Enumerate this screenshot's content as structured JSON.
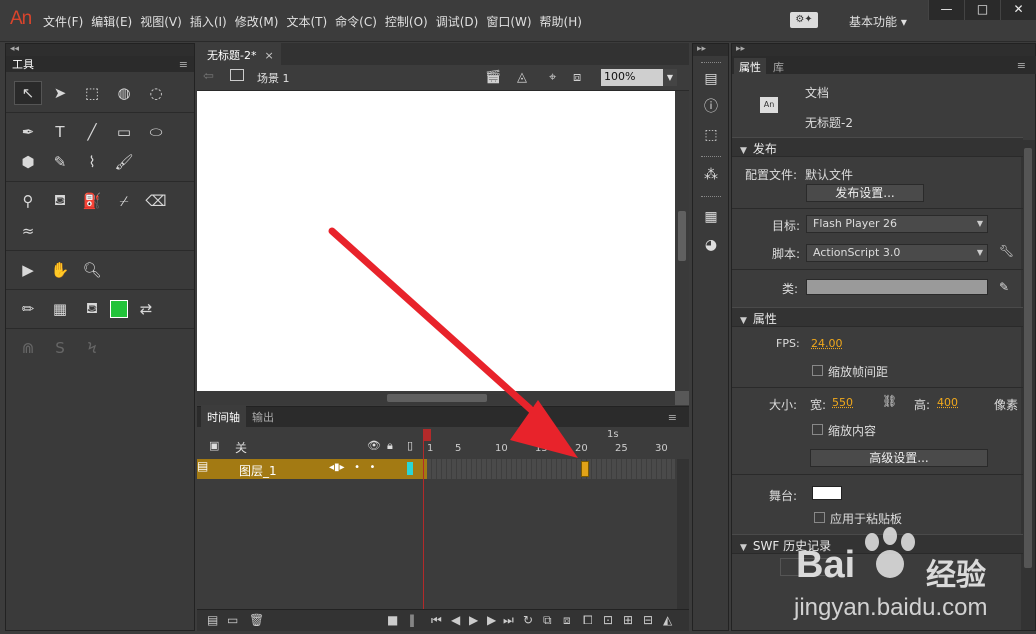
{
  "app": {
    "logo": "An",
    "menu": [
      "文件(F)",
      "编辑(E)",
      "视图(V)",
      "插入(I)",
      "修改(M)",
      "文本(T)",
      "命令(C)",
      "控制(O)",
      "调试(D)",
      "窗口(W)",
      "帮助(H)"
    ],
    "workspace": "基本功能",
    "window_controls": [
      "—",
      "□",
      "✕"
    ]
  },
  "tools_panel": {
    "title": "工具"
  },
  "document": {
    "tab_title": "无标题-2*",
    "scene": "场景 1",
    "zoom": "100%"
  },
  "timeline": {
    "tabs": [
      "时间轴",
      "输出"
    ],
    "header_label": "关",
    "layer_name": "图层_1",
    "ruler_numbers": [
      "1",
      "5",
      "10",
      "15",
      "20",
      "25",
      "30"
    ],
    "seconds_label": "1s",
    "keyframe_at": 20
  },
  "properties": {
    "tabs": [
      "属性",
      "库"
    ],
    "doc_icon_label": "An",
    "doc_type": "文档",
    "doc_name": "无标题-2",
    "publish": {
      "header": "发布",
      "profile_label": "配置文件:",
      "profile_value": "默认文件",
      "settings_button": "发布设置...",
      "target_label": "目标:",
      "target_value": "Flash Player 26",
      "script_label": "脚本:",
      "script_value": "ActionScript 3.0",
      "class_label": "类:"
    },
    "attributes": {
      "header": "属性",
      "fps_label": "FPS:",
      "fps_value": "24.00",
      "scale_spans": "缩放帧间距",
      "size_label": "大小:",
      "width_label": "宽:",
      "width_value": "550",
      "height_label": "高:",
      "height_value": "400",
      "unit": "像素",
      "scale_content": "缩放内容",
      "advanced_button": "高级设置...",
      "stage_label": "舞台:",
      "apply_clipboard": "应用于粘贴板"
    },
    "swf_history": {
      "header": "SWF 历史记录"
    }
  },
  "watermark": {
    "brand": "Bai",
    "brand_cn": "经验",
    "url": "jingyan.baidu.com"
  },
  "colors": {
    "accent": "#f0a81c",
    "layer_selected": "#a37a13",
    "arrow": "#e8232b",
    "swatch_fill": "#22c33a"
  }
}
